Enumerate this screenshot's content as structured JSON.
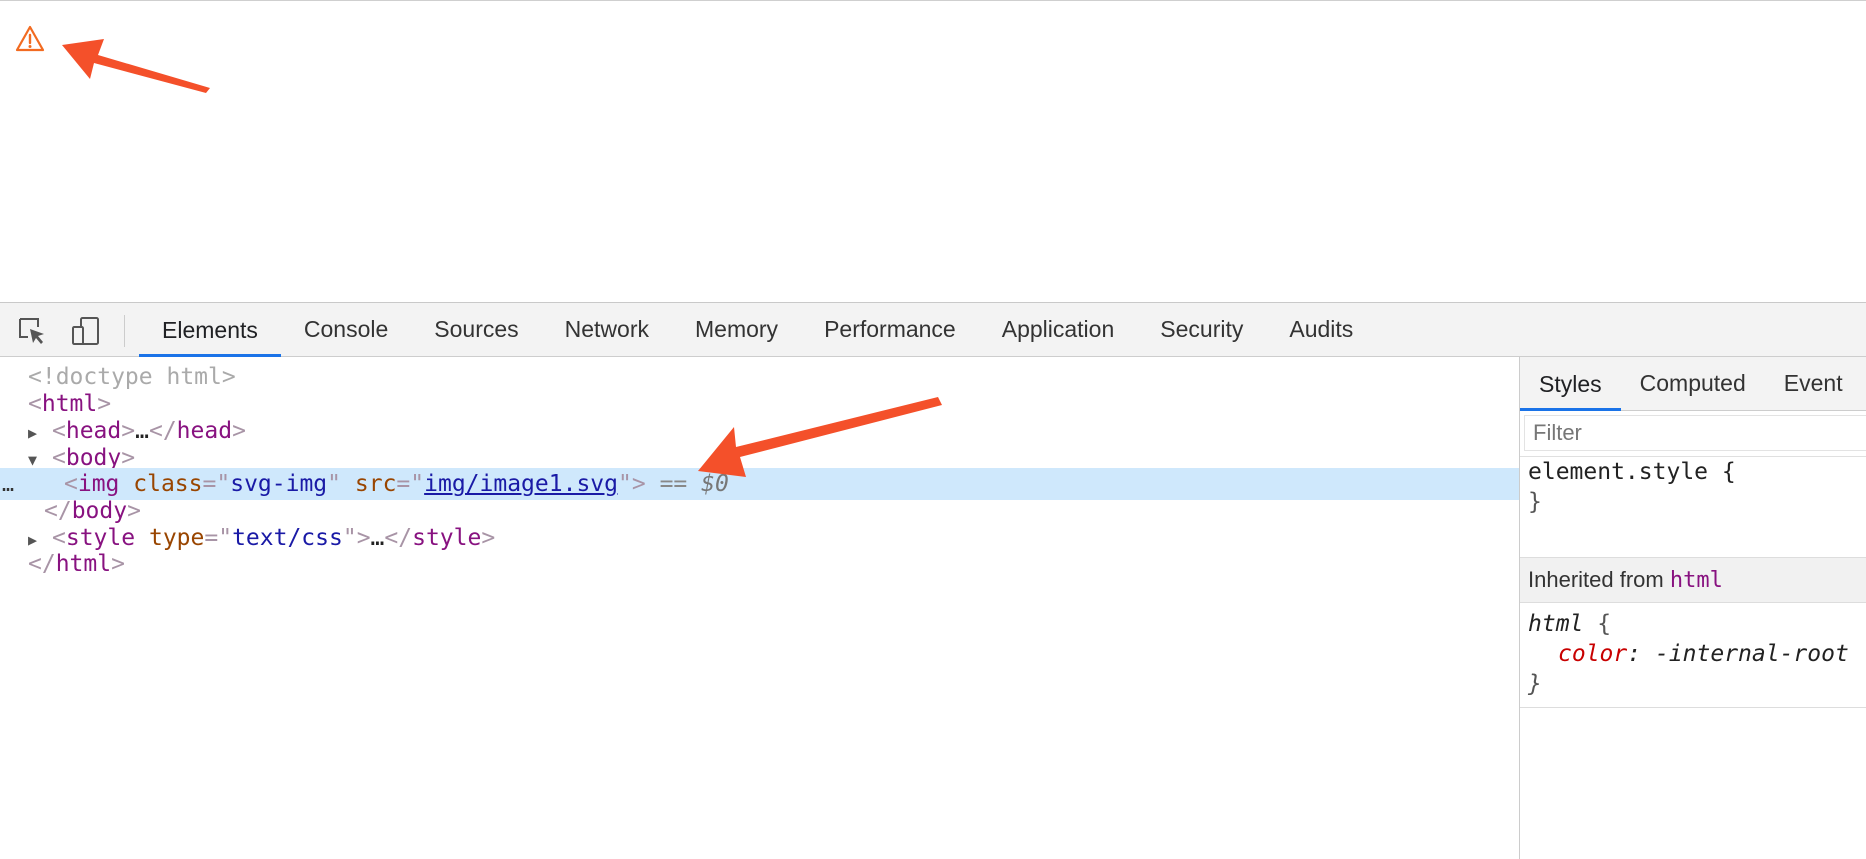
{
  "devtools": {
    "tabs": [
      {
        "label": "Elements",
        "active": true
      },
      {
        "label": "Console"
      },
      {
        "label": "Sources"
      },
      {
        "label": "Network"
      },
      {
        "label": "Memory"
      },
      {
        "label": "Performance"
      },
      {
        "label": "Application"
      },
      {
        "label": "Security"
      },
      {
        "label": "Audits"
      }
    ],
    "toolbar_icons": [
      "inspect-element-icon",
      "device-toolbar-icon"
    ]
  },
  "dom": {
    "doctype": "<!doctype html>",
    "html_open": "html",
    "head": "head",
    "ellipsis": "…",
    "body": "body",
    "img_tag": "img",
    "img_class_attr": "class",
    "img_class_val": "svg-img",
    "img_src_attr": "src",
    "img_src_val": "img/image1.svg",
    "selected_marker": "== ",
    "selected_var": "$0",
    "body_close": "body",
    "style_tag": "style",
    "style_type_attr": "type",
    "style_type_val": "text/css",
    "style_close": "style",
    "html_close": "html",
    "row_dots": "…"
  },
  "styles_pane": {
    "tabs": [
      {
        "label": "Styles",
        "active": true
      },
      {
        "label": "Computed"
      },
      {
        "label": "Event"
      }
    ],
    "filter_placeholder": "Filter",
    "element_style_selector": "element.style {",
    "close_brace": "}",
    "inherited_label": "Inherited from",
    "inherited_tag": "html",
    "html_selector": "html",
    "html_open_brace": " {",
    "html_prop": "color",
    "html_val": " -internal-root"
  },
  "colors": {
    "accent": "#1a73e8",
    "annotation_arrow": "#f4502a",
    "warning_icon": "#f26b21",
    "selected_row": "#cfe8fc"
  },
  "page_icons": [
    "warning-icon"
  ]
}
